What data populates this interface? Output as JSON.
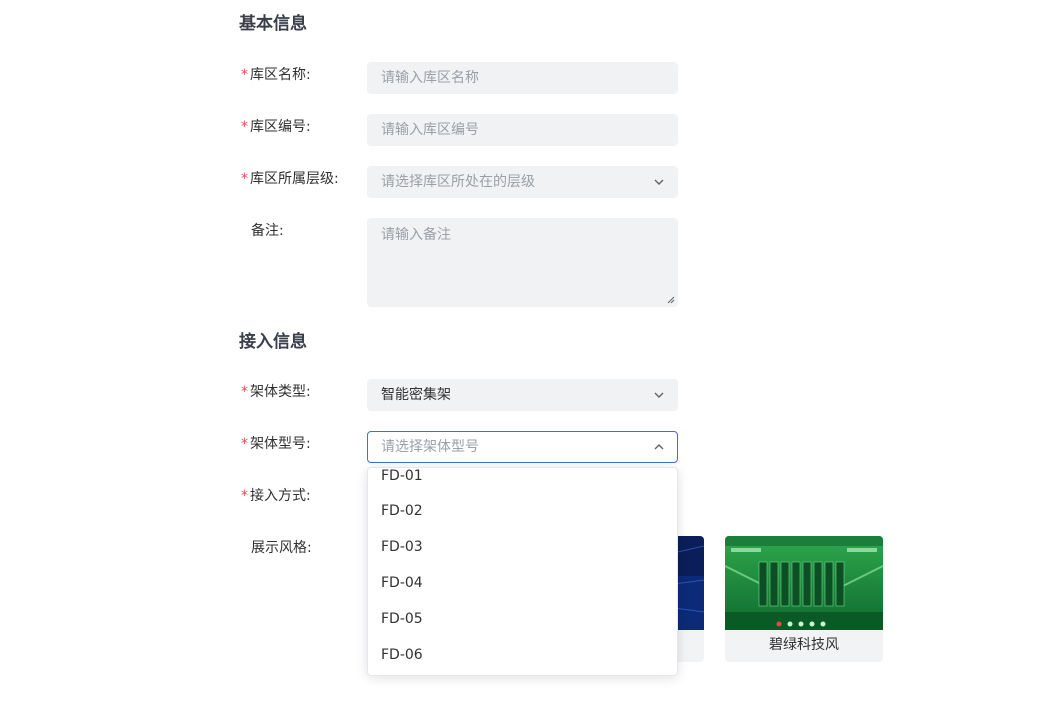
{
  "sections": {
    "basic_title": "基本信息",
    "access_title": "接入信息"
  },
  "form": {
    "required_mark": "*",
    "warehouse_name": {
      "label": "库区名称:",
      "placeholder": "请输入库区名称"
    },
    "warehouse_code": {
      "label": "库区编号:",
      "placeholder": "请输入库区编号"
    },
    "warehouse_level": {
      "label": "库区所属层级:",
      "placeholder": "请选择库区所处在的层级"
    },
    "remark": {
      "label": "备注:",
      "placeholder": "请输入备注"
    },
    "rack_type": {
      "label": "架体类型:",
      "value": "智能密集架"
    },
    "rack_model": {
      "label": "架体型号:",
      "placeholder": "请选择架体型号",
      "expanded": true
    },
    "access_method": {
      "label": "接入方式:"
    },
    "display_style": {
      "label": "展示风格:"
    }
  },
  "rack_model_options": [
    "FD-01",
    "FD-02",
    "FD-03",
    "FD-04",
    "FD-05",
    "FD-06"
  ],
  "style_cards": [
    {
      "caption": "",
      "theme": "dark-blue"
    },
    {
      "caption": "碧绿科技风",
      "theme": "green"
    }
  ],
  "colors": {
    "accent_border": "#3a6fe0",
    "required": "#e5484d",
    "input_bg": "#f1f2f4"
  }
}
